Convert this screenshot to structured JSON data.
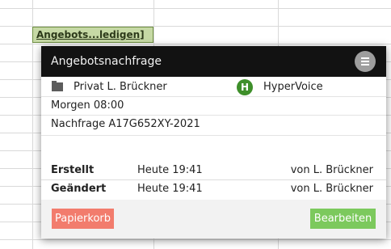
{
  "sheet": {
    "cell_chip": "Angebots...ledigen]"
  },
  "popup": {
    "title": "Angebotsnachfrage",
    "owner": "Privat L. Brückner",
    "hv_badge": "H",
    "hv_label": "HyperVoice",
    "due": "Morgen 08:00",
    "request": "Nachfrage A17G652XY-2021",
    "created": {
      "label": "Erstellt",
      "time": "Heute 19:41",
      "by": "von L. Brückner"
    },
    "changed": {
      "label": "Geändert",
      "time": "Heute 19:41",
      "by": "von L. Brückner"
    },
    "buttons": {
      "trash": "Papierkorb",
      "edit": "Bearbeiten"
    }
  },
  "colors": {
    "header_bg": "#121212",
    "chip_bg": "#c6d9a5",
    "hv_green": "#3e8f2a",
    "trash_button": "#f27c6d",
    "edit_button": "#7cc95d"
  },
  "icons": {
    "folder": "folder-icon",
    "menu": "menu-icon",
    "hypervoice": "hypervoice-logo"
  }
}
